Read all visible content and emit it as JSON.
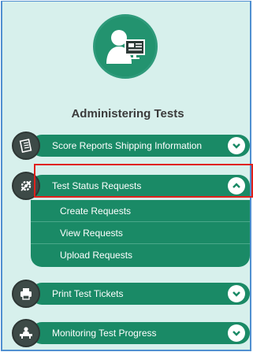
{
  "page_title": "Administering Tests",
  "items": [
    {
      "label": "Score Reports Shipping Information",
      "icon": "report-icon",
      "expanded": false
    },
    {
      "label": "Test Status Requests",
      "icon": "gear-slash-icon",
      "expanded": true,
      "subitems": [
        "Create Requests",
        "View Requests",
        "Upload Requests"
      ]
    },
    {
      "label": "Print Test Tickets",
      "icon": "printer-icon",
      "expanded": false
    },
    {
      "label": "Monitoring Test Progress",
      "icon": "monitor-user-icon",
      "expanded": false
    }
  ],
  "colors": {
    "background": "#d7f0ec",
    "bar": "#1a8a66",
    "icon_circle": "#3d4a47",
    "highlight": "#e0201b"
  }
}
